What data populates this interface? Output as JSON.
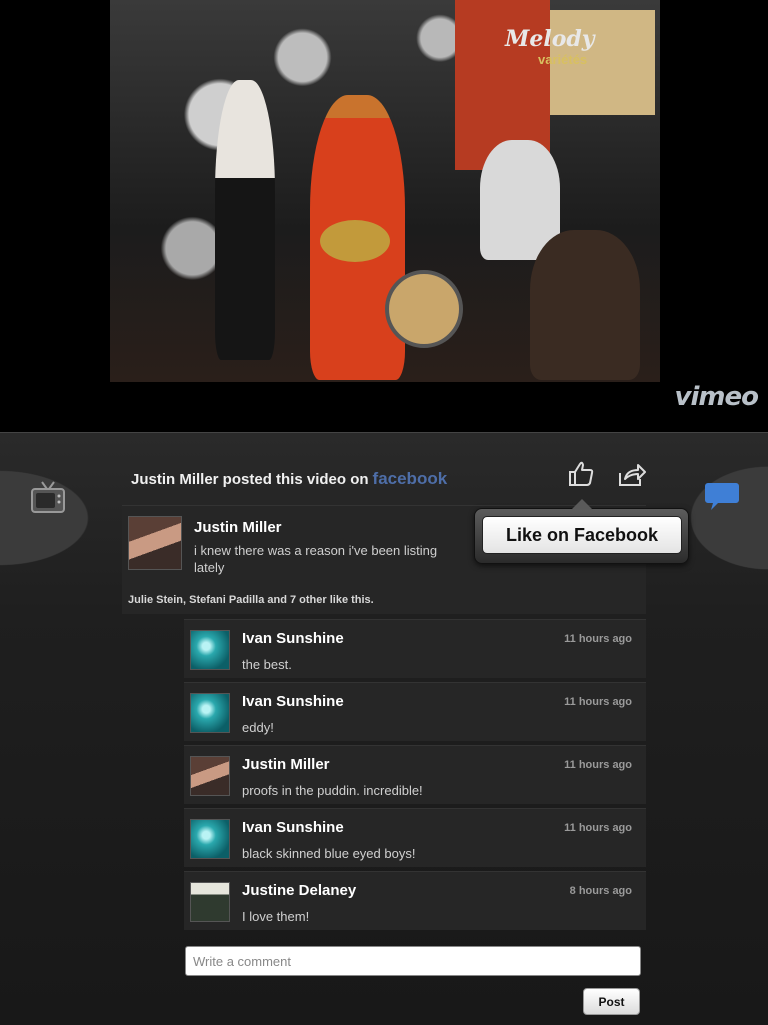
{
  "video": {
    "overlay_logo": "Melody",
    "overlay_sub": "variétés",
    "brand": "vimeo"
  },
  "header": {
    "posted_text": "Justin Miller posted this video on",
    "network": "facebook"
  },
  "icons": {
    "tv": "tv-icon",
    "chat": "chat-bubble-icon",
    "like": "thumbs-up-icon",
    "share": "share-icon"
  },
  "colors": {
    "facebook_blue": "#4e6ea8",
    "chat_blue": "#3f7fd6"
  },
  "post": {
    "name": "Justin Miller",
    "text_line1": "i knew there was a reason i've been listing",
    "text_line2": "lately",
    "likes": "Julie Stein, Stefani Padilla and 7 other like this."
  },
  "popover": {
    "label": "Like on Facebook"
  },
  "replies": [
    {
      "name": "Ivan Sunshine",
      "time": "11 hours ago",
      "text": "the best."
    },
    {
      "name": "Ivan Sunshine",
      "time": "11 hours ago",
      "text": "eddy!"
    },
    {
      "name": "Justin Miller",
      "time": "11 hours ago",
      "text": "proofs in the puddin. incredible!"
    },
    {
      "name": "Ivan Sunshine",
      "time": "11 hours ago",
      "text": "black skinned blue eyed boys!"
    },
    {
      "name": "Justine Delaney",
      "time": "8 hours ago",
      "text": "I love them!"
    }
  ],
  "composer": {
    "placeholder": "Write a comment",
    "post_label": "Post"
  }
}
